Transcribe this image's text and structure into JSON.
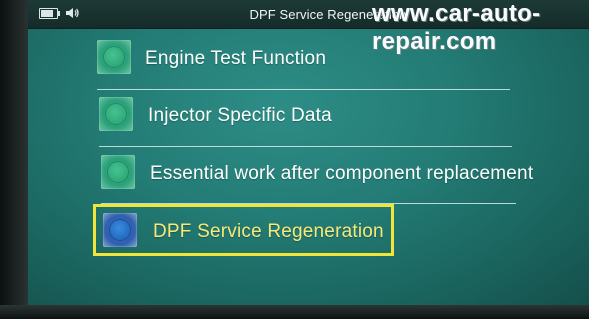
{
  "status_bar": {
    "battery_icon": "battery-icon",
    "speaker_icon": "speaker-icon",
    "title": "DPF Service Regeneration"
  },
  "watermark": "www.car-auto-repair.com",
  "menu": {
    "items": [
      {
        "label": "Engine Test Function",
        "icon": "green-circle-icon",
        "selected": false
      },
      {
        "label": "Injector Specific Data",
        "icon": "green-circle-icon",
        "selected": false
      },
      {
        "label": "Essential work after component replacement",
        "icon": "green-circle-icon",
        "selected": false
      },
      {
        "label": "DPF Service Regeneration",
        "icon": "blue-circle-icon",
        "selected": true
      }
    ]
  },
  "colors": {
    "screen_bg": "#237c75",
    "highlight": "#f0e63a",
    "selected_text": "#f7e97a",
    "text": "#ffffff"
  }
}
